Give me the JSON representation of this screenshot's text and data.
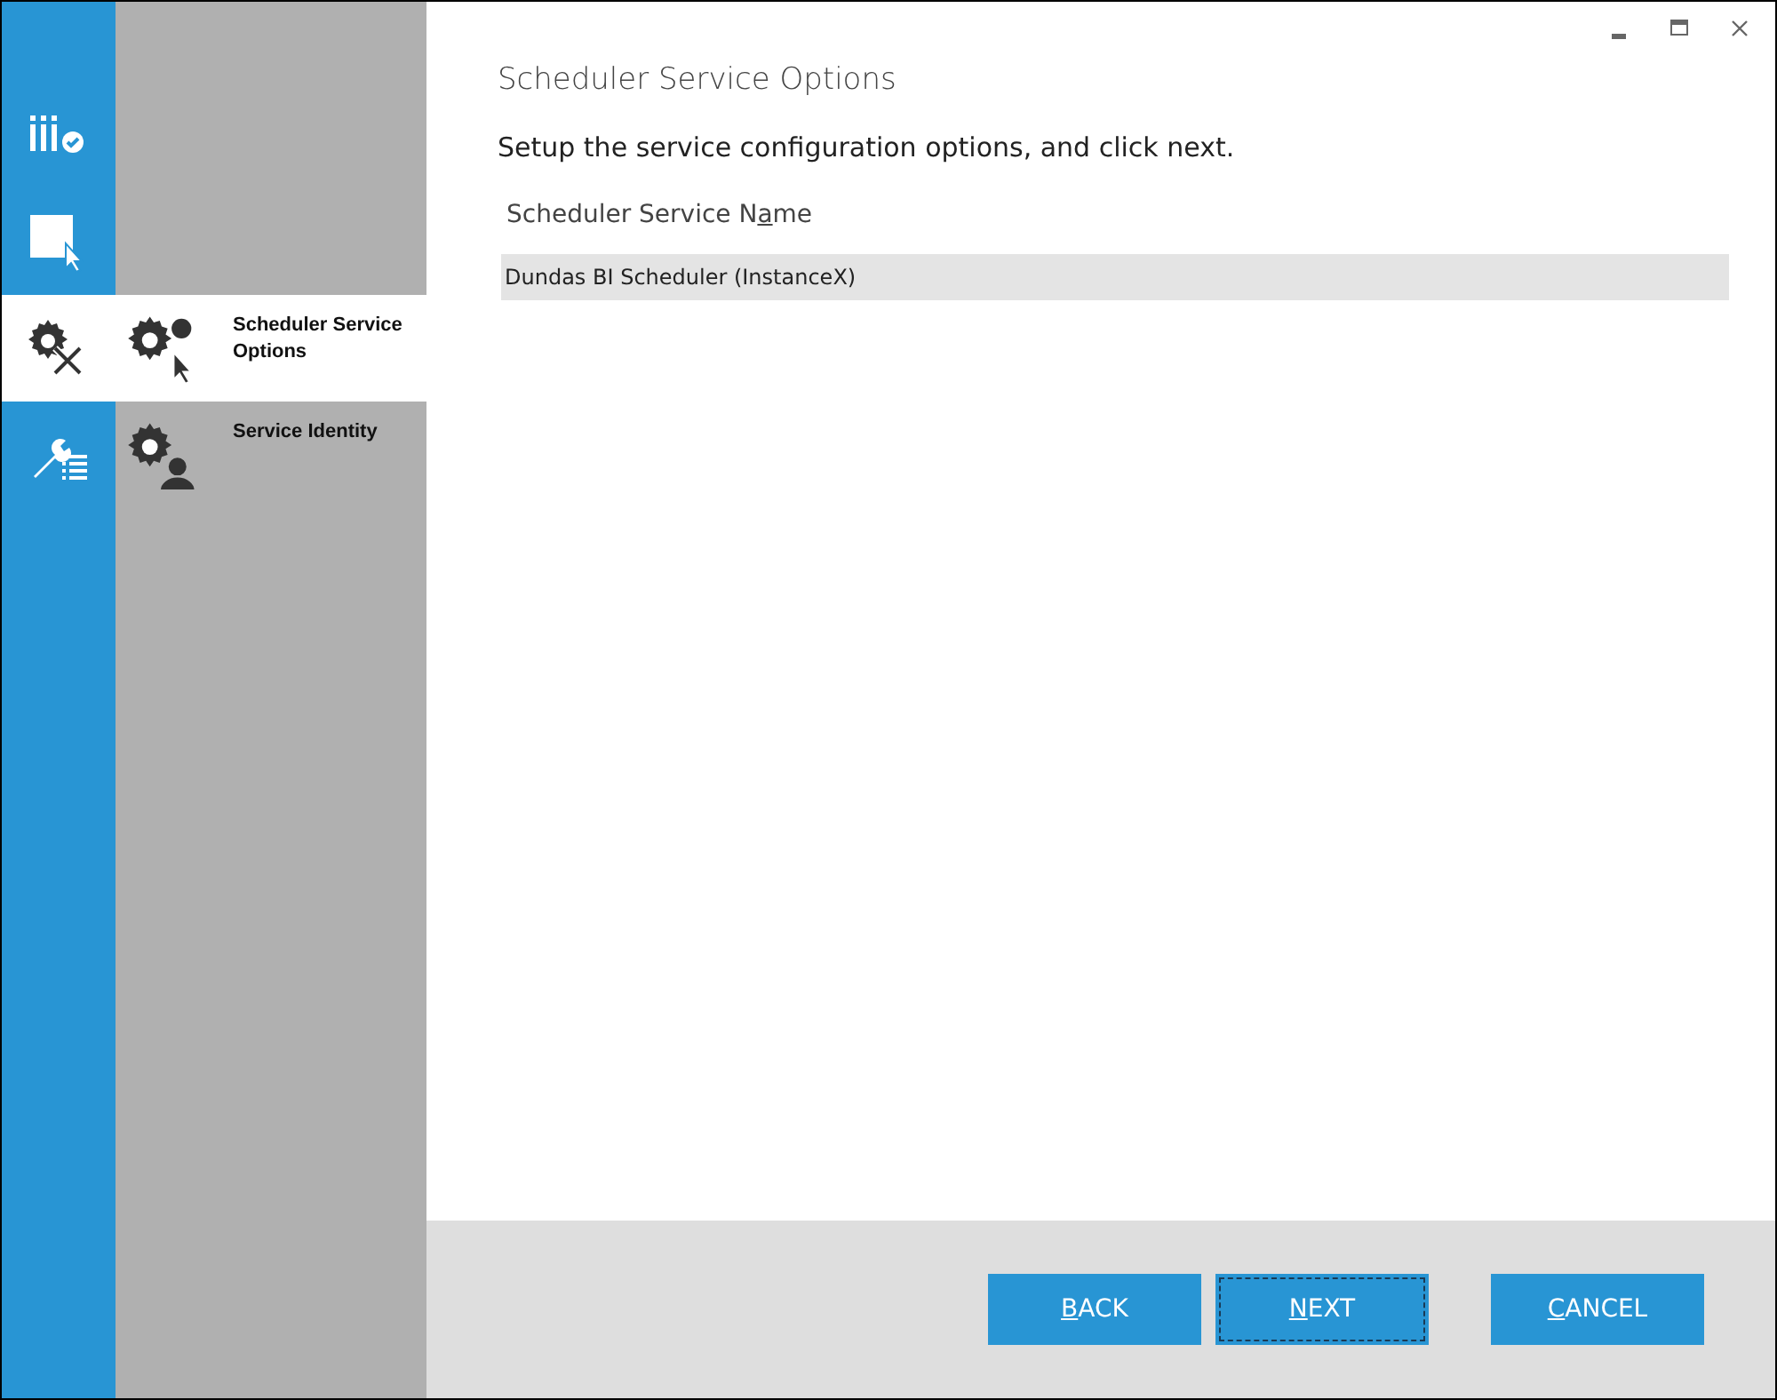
{
  "window": {
    "controls": [
      {
        "kind": "minimize"
      },
      {
        "kind": "maximize"
      },
      {
        "kind": "close"
      }
    ]
  },
  "sidebar": {
    "steps": [
      {
        "selected": false
      },
      {
        "selected": false
      },
      {
        "selected": true,
        "label": "Scheduler Service Options"
      },
      {
        "selected": false,
        "label": "Service Identity"
      }
    ]
  },
  "page": {
    "title": "Scheduler Service Options",
    "instruction": "Setup the service configuration options, and click next.",
    "field": {
      "label_before": "Scheduler Service N",
      "label_key": "a",
      "label_after": "me",
      "value": "Dundas BI Scheduler (InstanceX)"
    }
  },
  "buttons": [
    {
      "key": "B",
      "rest": "ACK",
      "focused": false
    },
    {
      "key": "N",
      "rest": "EXT",
      "focused": true
    },
    {
      "key": "C",
      "rest": "ANCEL",
      "focused": false
    }
  ]
}
